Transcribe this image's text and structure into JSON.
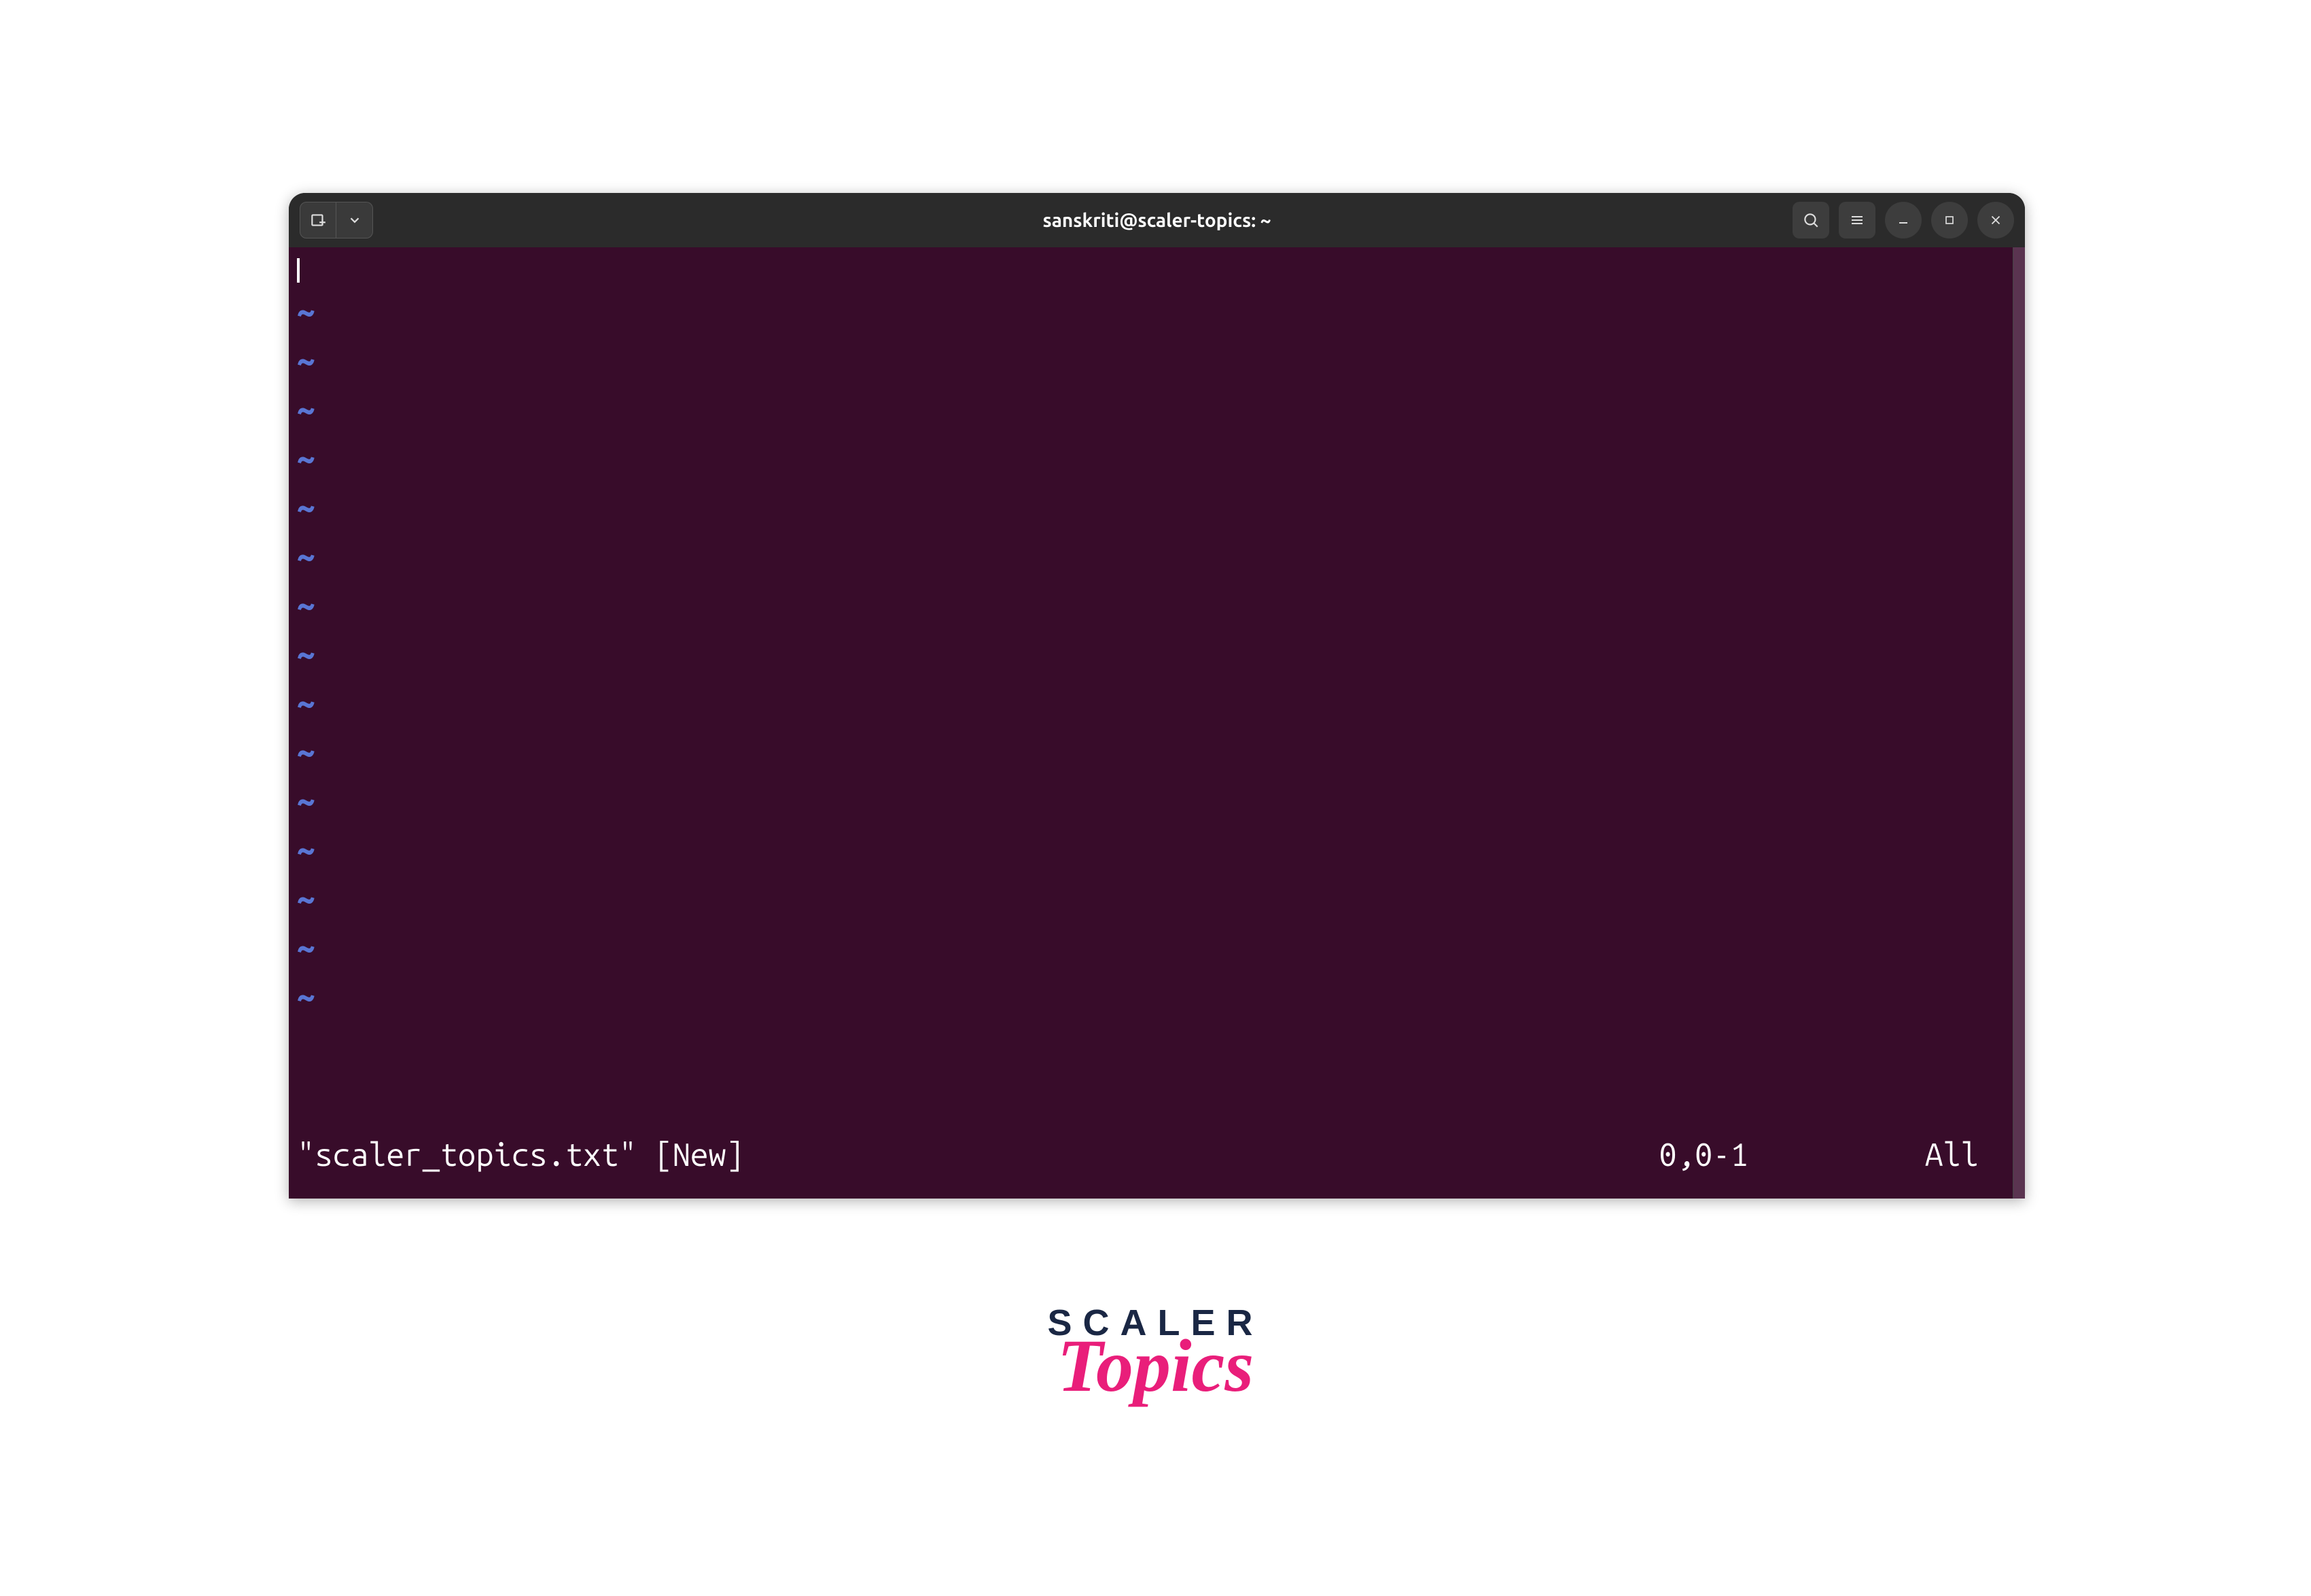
{
  "titlebar": {
    "title": "sanskriti@scaler-topics: ~"
  },
  "editor": {
    "tilde": "~",
    "tilde_count": 15,
    "status": {
      "filename": "\"scaler_topics.txt\" [New]",
      "position": "0,0-1",
      "percent": "All"
    }
  },
  "logo": {
    "line1": "SCALER",
    "line2": "Topics"
  }
}
